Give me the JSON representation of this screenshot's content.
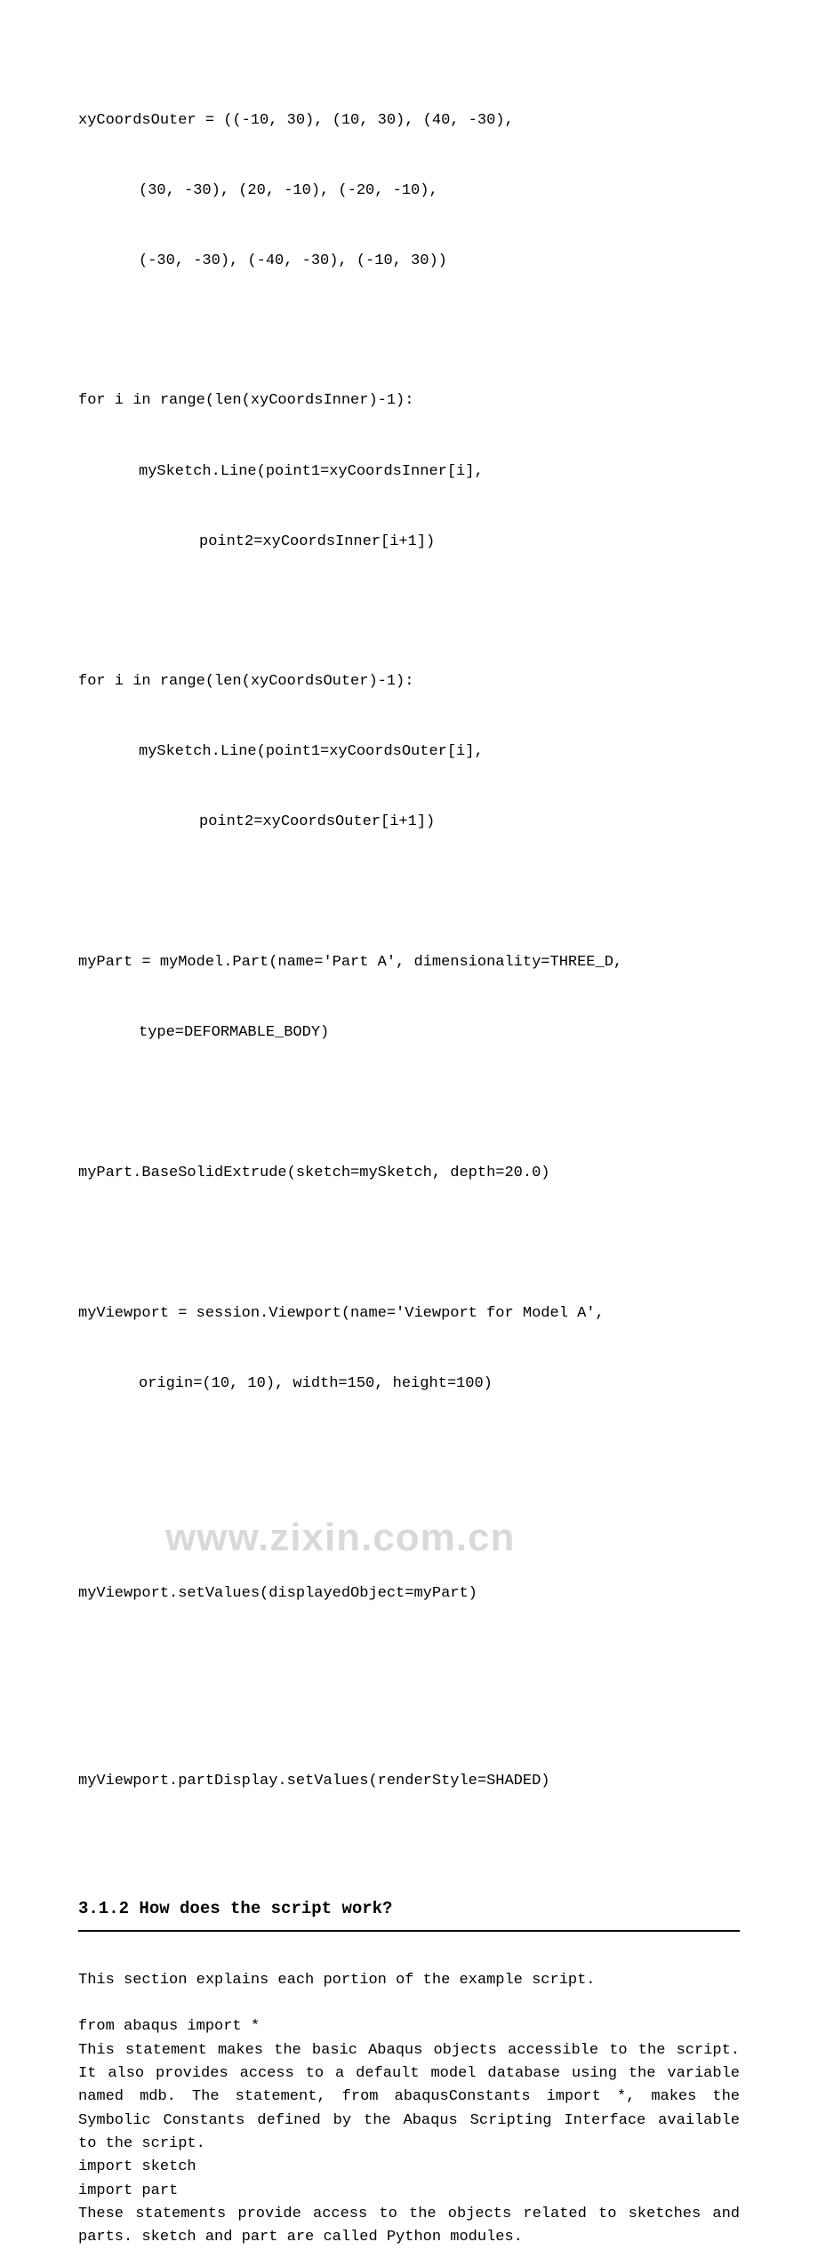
{
  "code": {
    "l1": "xyCoordsOuter = ((-10, 30), (10, 30), (40, -30),",
    "l2": "(30, -30), (20, -10), (-20, -10),",
    "l3": "(-30, -30), (-40, -30), (-10, 30))",
    "l4": "for i in range(len(xyCoordsInner)-1):",
    "l5": "mySketch.Line(point1=xyCoordsInner[i],",
    "l6": "point2=xyCoordsInner[i+1])",
    "l7": "for i in range(len(xyCoordsOuter)-1):",
    "l8": "mySketch.Line(point1=xyCoordsOuter[i],",
    "l9": "point2=xyCoordsOuter[i+1])",
    "l10": "myPart = myModel.Part(name='Part A', dimensionality=THREE_D,",
    "l11": "type=DEFORMABLE_BODY)",
    "l12": "myPart.BaseSolidExtrude(sketch=mySketch, depth=20.0)",
    "l13": "myViewport = session.Viewport(name='Viewport for Model A',",
    "l14": "origin=(10, 10), width=150, height=100)",
    "l15": "myViewport.setValues(displayedObject=myPart)",
    "l16": "myViewport.partDisplay.setValues(renderStyle=SHADED)"
  },
  "watermark": "www.zixin.com.cn",
  "heading": "3.1.2 How does the script work?",
  "body": {
    "p1": "This section explains each portion of the example script.",
    "p2a": "from abaqus import *",
    "p2b": "This statement makes the basic Abaqus objects accessible to the script. It also provides access to a default model database using the variable named mdb. The statement, from abaqusConstants import *, makes the Symbolic Constants defined by the Abaqus Scripting Interface available to the script.",
    "p2c": "import sketch",
    "p2d": "import part",
    "p2e": "These statements provide access to the objects related to sketches and parts. sketch and part are called Python modules."
  }
}
